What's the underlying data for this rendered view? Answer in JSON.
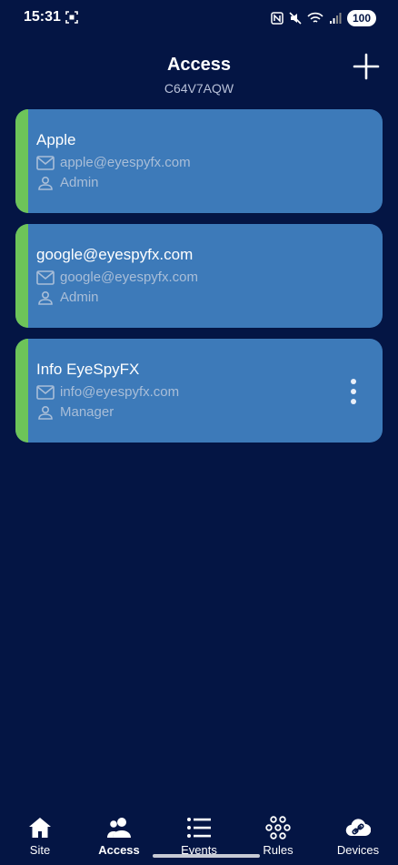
{
  "status_bar": {
    "time": "15:31",
    "battery": "100"
  },
  "header": {
    "title": "Access",
    "subtitle": "C64V7AQW"
  },
  "users": [
    {
      "name": "Apple",
      "email": "apple@eyespyfx.com",
      "role": "Admin",
      "show_menu": false
    },
    {
      "name": "google@eyespyfx.com",
      "email": "google@eyespyfx.com",
      "role": "Admin",
      "show_menu": false
    },
    {
      "name": "Info EyeSpyFX",
      "email": "info@eyespyfx.com",
      "role": "Manager",
      "show_menu": true
    }
  ],
  "nav": {
    "items": [
      {
        "label": "Site",
        "icon": "home-icon"
      },
      {
        "label": "Access",
        "icon": "users-icon"
      },
      {
        "label": "Events",
        "icon": "list-icon"
      },
      {
        "label": "Rules",
        "icon": "rules-icon"
      },
      {
        "label": "Devices",
        "icon": "cloud-link-icon"
      }
    ],
    "active": "Access"
  },
  "colors": {
    "background": "#041544",
    "card": "#3d7ab9",
    "accent": "#6dc459",
    "muted_text": "#a9bed8"
  }
}
